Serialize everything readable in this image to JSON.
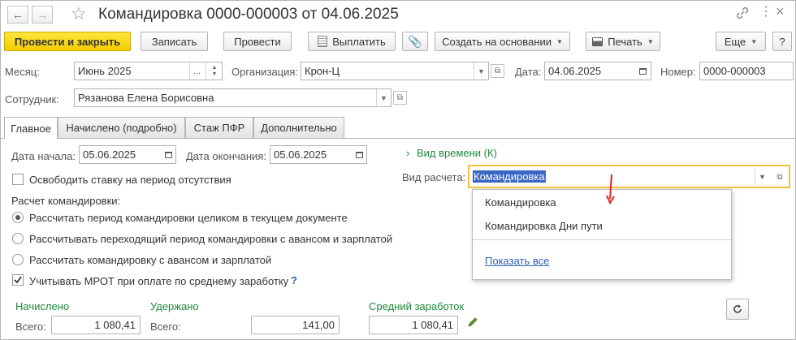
{
  "window": {
    "title": "Командировка 0000-000003 от 04.06.2025"
  },
  "toolbar": {
    "post_close": "Провести и закрыть",
    "save": "Записать",
    "post": "Провести",
    "pay": "Выплатить",
    "create_based": "Создать на основании",
    "print": "Печать",
    "more": "Еще",
    "help": "?"
  },
  "header": {
    "month_label": "Месяц:",
    "month_value": "Июнь 2025",
    "month_dots": "...",
    "org_label": "Организация:",
    "org_value": "Крон-Ц",
    "date_label": "Дата:",
    "date_value": "04.06.2025",
    "number_label": "Номер:",
    "number_value": "0000-000003",
    "employee_label": "Сотрудник:",
    "employee_value": "Рязанова Елена Борисовна"
  },
  "tabs": [
    {
      "label": "Главное"
    },
    {
      "label": "Начислено (подробно)"
    },
    {
      "label": "Стаж ПФР"
    },
    {
      "label": "Дополнительно"
    }
  ],
  "main": {
    "start_label": "Дата начала:",
    "start_value": "05.06.2025",
    "end_label": "Дата окончания:",
    "end_value": "05.06.2025",
    "free_rate": "Освободить ставку на период отсутствия",
    "calc_title": "Расчет командировки:",
    "radio1": "Рассчитать период командировки целиком в текущем документе",
    "radio2": "Рассчитывать переходящий период командировки с авансом и зарплатой",
    "radio3": "Рассчитать командировку с авансом и зарплатой",
    "mrot": "Учитывать МРОТ при оплате по среднему заработку",
    "mrot_help": "?",
    "time_kind": "Вид времени (К)",
    "calc_kind_label": "Вид расчета:",
    "calc_kind_value": "Командировка"
  },
  "dropdown": {
    "items": [
      "Командировка",
      "Командировка Дни пути"
    ],
    "show_all": "Показать все"
  },
  "totals": {
    "accrued_title": "Начислено",
    "withheld_title": "Удержано",
    "avg_title": "Средний заработок",
    "total_label": "Всего:",
    "accrued_value": "1 080,41",
    "withheld_value": "141,00",
    "avg_value": "1 080,41"
  },
  "colors": {
    "accent_yellow": "#f5cd00",
    "green_text": "#1e8a3a",
    "selection_blue": "#3a66c4",
    "arrow_red": "#e02020",
    "field_focus": "#f0c040"
  }
}
